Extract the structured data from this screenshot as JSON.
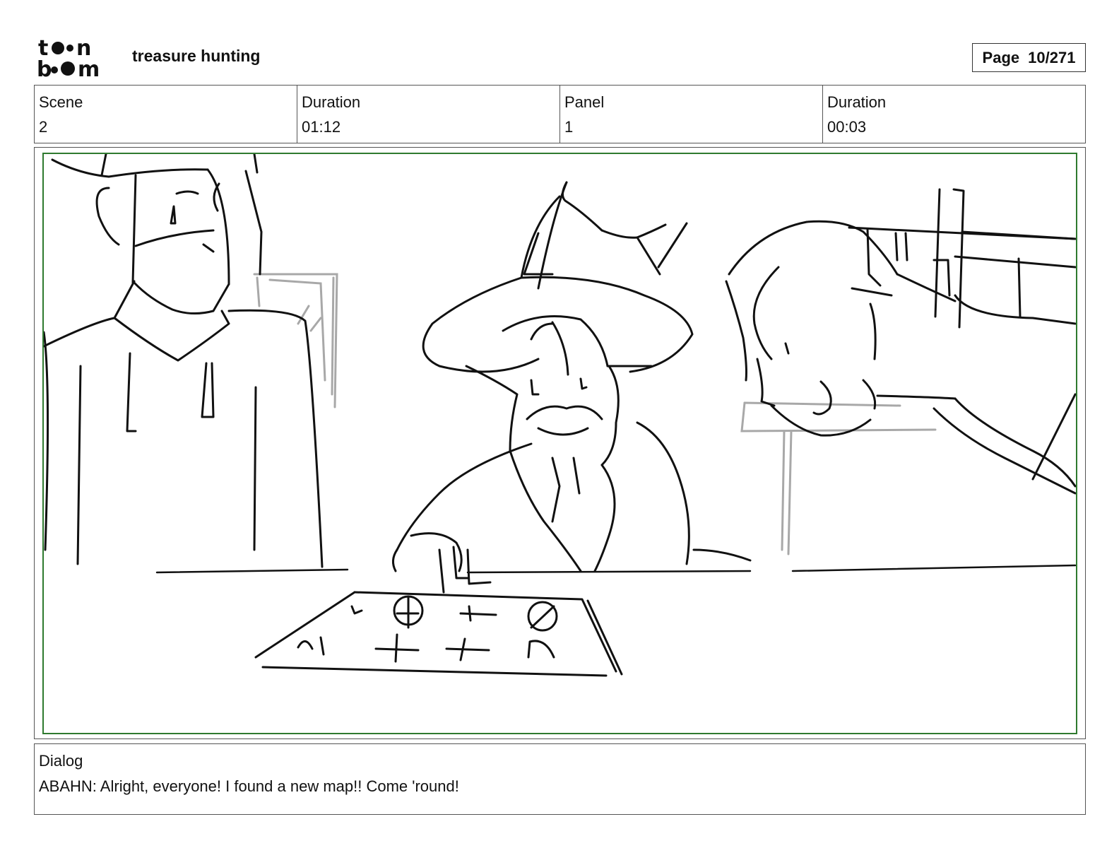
{
  "header": {
    "logo_text": "toon boom",
    "project_title": "treasure hunting",
    "page_label": "Page",
    "page_number": "10/271"
  },
  "info": {
    "scene_label": "Scene",
    "scene_value": "2",
    "scene_duration_label": "Duration",
    "scene_duration_value": "01:12",
    "panel_label": "Panel",
    "panel_value": "1",
    "panel_duration_label": "Duration",
    "panel_duration_value": "00:03"
  },
  "dialog": {
    "label": "Dialog",
    "text": "ABAHN: Alright, everyone! I found a new map!! Come 'round!"
  },
  "colors": {
    "safe_area_border": "#2f7a2f",
    "sketch_line": "#111111",
    "background_sketch": "#a8a8a8"
  }
}
